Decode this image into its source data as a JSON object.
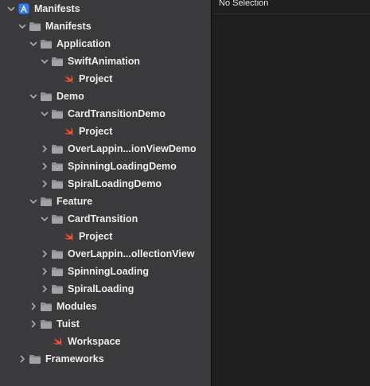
{
  "editor": {
    "placeholder": "No Selection"
  },
  "tree": [
    {
      "label": "Manifests",
      "kind": "app",
      "depth": 0,
      "expanded": true
    },
    {
      "label": "Manifests",
      "kind": "folder",
      "depth": 1,
      "expanded": true
    },
    {
      "label": "Application",
      "kind": "folder",
      "depth": 2,
      "expanded": true
    },
    {
      "label": "SwiftAnimation",
      "kind": "folder",
      "depth": 3,
      "expanded": true
    },
    {
      "label": "Project",
      "kind": "swift",
      "depth": 4,
      "expanded": null
    },
    {
      "label": "Demo",
      "kind": "folder",
      "depth": 2,
      "expanded": true
    },
    {
      "label": "CardTransitionDemo",
      "kind": "folder",
      "depth": 3,
      "expanded": true
    },
    {
      "label": "Project",
      "kind": "swift",
      "depth": 4,
      "expanded": null
    },
    {
      "label": "OverLappin...ionViewDemo",
      "kind": "folder",
      "depth": 3,
      "expanded": false
    },
    {
      "label": "SpinningLoadingDemo",
      "kind": "folder",
      "depth": 3,
      "expanded": false
    },
    {
      "label": "SpiralLoadingDemo",
      "kind": "folder",
      "depth": 3,
      "expanded": false
    },
    {
      "label": "Feature",
      "kind": "folder",
      "depth": 2,
      "expanded": true
    },
    {
      "label": "CardTransition",
      "kind": "folder",
      "depth": 3,
      "expanded": true
    },
    {
      "label": "Project",
      "kind": "swift",
      "depth": 4,
      "expanded": null
    },
    {
      "label": "OverLappin...ollectionView",
      "kind": "folder",
      "depth": 3,
      "expanded": false
    },
    {
      "label": "SpinningLoading",
      "kind": "folder",
      "depth": 3,
      "expanded": false
    },
    {
      "label": "SpiralLoading",
      "kind": "folder",
      "depth": 3,
      "expanded": false
    },
    {
      "label": "Modules",
      "kind": "folder",
      "depth": 2,
      "expanded": false
    },
    {
      "label": "Tuist",
      "kind": "folder",
      "depth": 2,
      "expanded": false
    },
    {
      "label": "Workspace",
      "kind": "swift",
      "depth": 3,
      "expanded": null
    },
    {
      "label": "Frameworks",
      "kind": "folder",
      "depth": 1,
      "expanded": false
    }
  ]
}
